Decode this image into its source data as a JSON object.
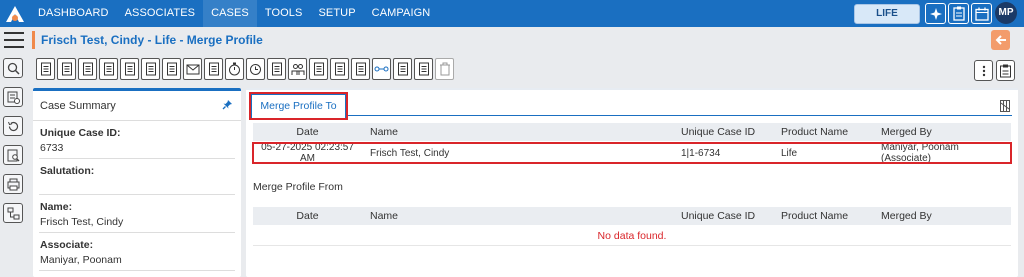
{
  "nav": {
    "items": [
      "DASHBOARD",
      "ASSOCIATES",
      "CASES",
      "TOOLS",
      "SETUP",
      "CAMPAIGN"
    ],
    "active": "CASES",
    "product_button": "LIFE",
    "user_initials": "MP"
  },
  "header": {
    "title": "Frisch Test, Cindy - Life - Merge Profile"
  },
  "summary": {
    "title": "Case Summary",
    "fields": [
      {
        "label": "Unique Case ID:",
        "value": "6733"
      },
      {
        "label": "Salutation:",
        "value": ""
      },
      {
        "label": "Name:",
        "value": "Frisch Test, Cindy"
      },
      {
        "label": "Associate:",
        "value": "Maniyar, Poonam"
      }
    ]
  },
  "merge_to": {
    "tab_label": "Merge Profile To",
    "columns": [
      "Date",
      "Name",
      "Unique Case ID",
      "Product Name",
      "Merged By"
    ],
    "rows": [
      [
        "05-27-2025 02:23:57 AM",
        "Frisch Test, Cindy",
        "1|1-6734",
        "Life",
        "Maniyar, Poonam (Associate)"
      ]
    ]
  },
  "merge_from": {
    "title": "Merge Profile From",
    "columns": [
      "Date",
      "Name",
      "Unique Case ID",
      "Product Name",
      "Merged By"
    ],
    "empty_text": "No data found."
  },
  "colors": {
    "brand": "#1a6fc1",
    "accent": "#f08a4b",
    "highlight": "#d9252a"
  },
  "icons": {
    "toolbar": [
      "case-edit-icon",
      "profile-card-icon",
      "search-doc-icon",
      "document-icon",
      "copy-icon",
      "add-doc-icon",
      "upload-icon",
      "email-icon",
      "print-icon",
      "stopwatch-icon",
      "clock-icon",
      "compare-icon",
      "users-icon",
      "report-icon",
      "list-icon",
      "email-open-icon",
      "merge-icon",
      "billing-icon",
      "transfer-icon",
      "trash-icon"
    ],
    "rail": [
      "search-icon",
      "add-list-icon",
      "history-icon",
      "doc-search-icon",
      "print-doc-icon",
      "hierarchy-icon"
    ]
  }
}
